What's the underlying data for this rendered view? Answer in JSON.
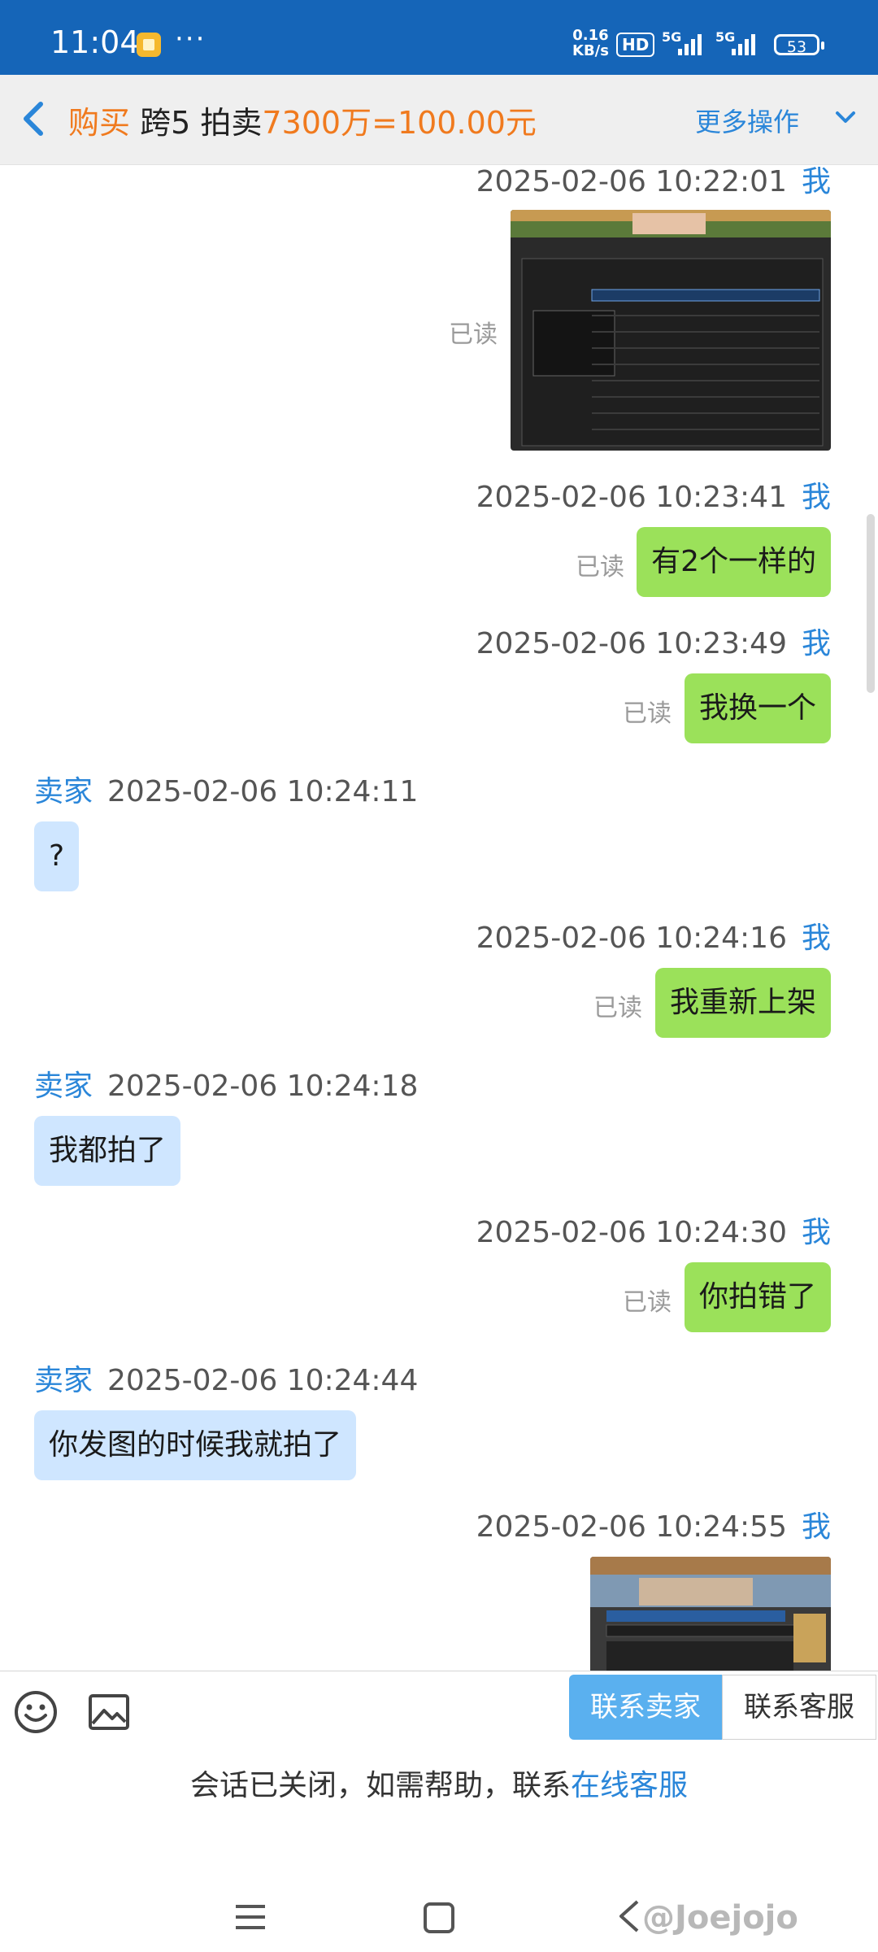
{
  "status_bar": {
    "time": "11:04",
    "net_speed_value": "0.16",
    "net_speed_unit": "KB/s",
    "hd_label": "HD",
    "sim1_label": "5G",
    "sim2_label": "5G",
    "battery": "53"
  },
  "header": {
    "back_icon": "chevron-left-icon",
    "category": "购买",
    "server": "跨5",
    "item_type": "拍卖",
    "price": "7300万=100.00元",
    "more_label": "更多操作",
    "more_icon": "chevron-down-icon"
  },
  "messages": [
    {
      "sender": "我",
      "time": "2025-02-06 10:22:01",
      "type": "image",
      "status": "已读"
    },
    {
      "sender": "我",
      "time": "2025-02-06 10:23:41",
      "type": "text",
      "text": "有2个一样的",
      "status": "已读"
    },
    {
      "sender": "我",
      "time": "2025-02-06 10:23:49",
      "type": "text",
      "text": "我换一个",
      "status": "已读"
    },
    {
      "sender": "卖家",
      "time": "2025-02-06 10:24:11",
      "type": "text",
      "text": "?"
    },
    {
      "sender": "我",
      "time": "2025-02-06 10:24:16",
      "type": "text",
      "text": "我重新上架",
      "status": "已读"
    },
    {
      "sender": "卖家",
      "time": "2025-02-06 10:24:18",
      "type": "text",
      "text": "我都拍了"
    },
    {
      "sender": "我",
      "time": "2025-02-06 10:24:30",
      "type": "text",
      "text": "你拍错了",
      "status": "已读"
    },
    {
      "sender": "卖家",
      "time": "2025-02-06 10:24:44",
      "type": "text",
      "text": "你发图的时候我就拍了"
    },
    {
      "sender": "我",
      "time": "2025-02-06 10:24:55",
      "type": "image"
    }
  ],
  "toolbar": {
    "emoji_icon": "emoji-icon",
    "image_icon": "image-icon",
    "contact_seller": "联系卖家",
    "contact_service": "联系客服"
  },
  "closed_note": {
    "text": "会话已关闭，如需帮助，联系",
    "link": "在线客服"
  },
  "watermark": "@Joejojo",
  "colors": {
    "status_bar": "#1565b8",
    "accent_blue": "#2a86d9",
    "orange": "#f07a1e",
    "my_bubble": "#9be15a",
    "seller_bubble": "#cfe6ff",
    "seller_button": "#5ab0ef"
  }
}
